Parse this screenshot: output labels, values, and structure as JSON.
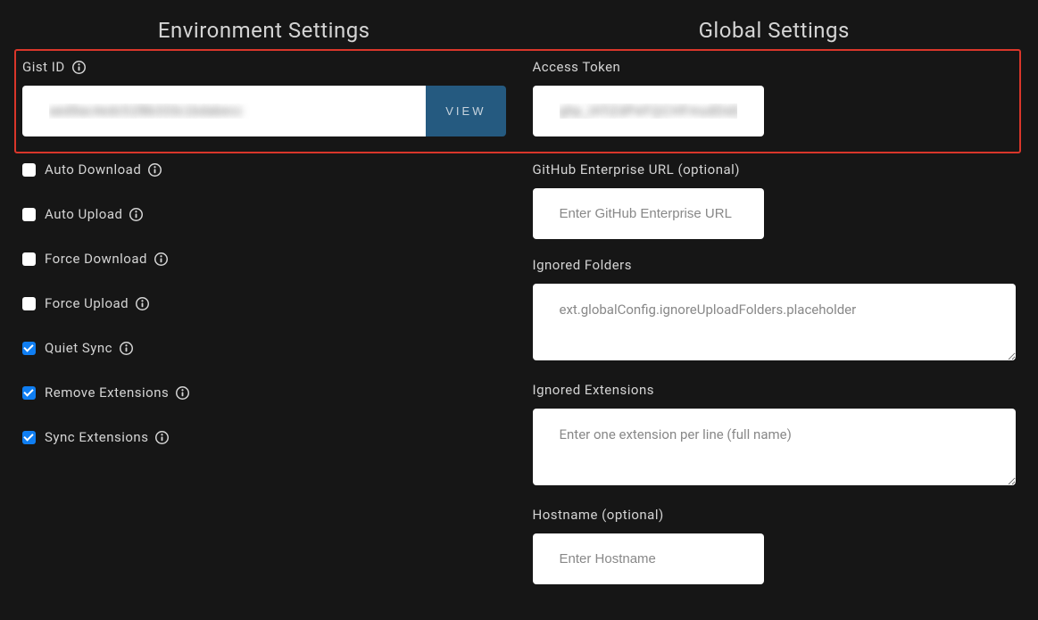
{
  "environment": {
    "header": "Environment Settings",
    "gist": {
      "label": "Gist ID",
      "value": "aed9ac4edc51f8b333c1bdabecc",
      "view_button": "VIEW"
    },
    "checkboxes": {
      "auto_download": {
        "label": "Auto Download",
        "checked": false
      },
      "auto_upload": {
        "label": "Auto Upload",
        "checked": false
      },
      "force_download": {
        "label": "Force Download",
        "checked": false
      },
      "force_upload": {
        "label": "Force Upload",
        "checked": false
      },
      "quiet_sync": {
        "label": "Quiet Sync",
        "checked": true
      },
      "remove_extensions": {
        "label": "Remove Extensions",
        "checked": true
      },
      "sync_extensions": {
        "label": "Sync Extensions",
        "checked": true
      }
    }
  },
  "global": {
    "header": "Global Settings",
    "access_token": {
      "label": "Access Token",
      "value": "ghp_lATiZdPeFQCHFmudDsEJPc8o229RI468lij"
    },
    "github_enterprise": {
      "label": "GitHub Enterprise URL (optional)",
      "placeholder": "Enter GitHub Enterprise URL",
      "value": ""
    },
    "ignored_folders": {
      "label": "Ignored Folders",
      "placeholder": "ext.globalConfig.ignoreUploadFolders.placeholder",
      "value": ""
    },
    "ignored_extensions": {
      "label": "Ignored Extensions",
      "placeholder": "Enter one extension per line (full name)",
      "value": ""
    },
    "hostname": {
      "label": "Hostname (optional)",
      "placeholder": "Enter Hostname",
      "value": ""
    }
  }
}
